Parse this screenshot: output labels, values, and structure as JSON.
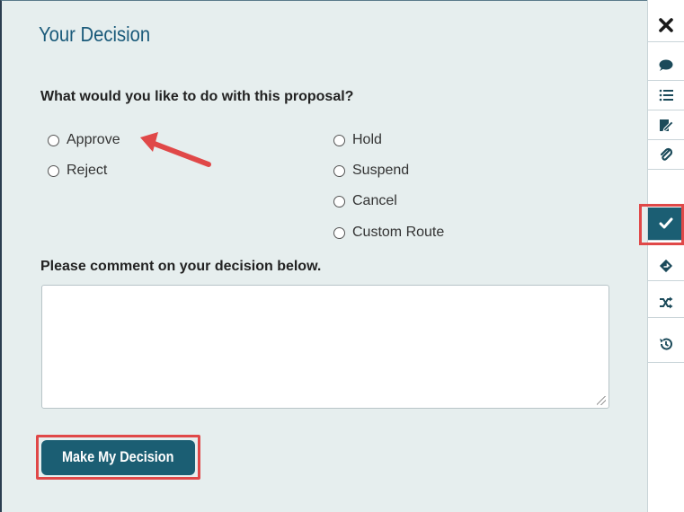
{
  "panel": {
    "title": "Your Decision",
    "question": "What would you like to do with this proposal?",
    "options": {
      "approve": "Approve",
      "reject": "Reject",
      "hold": "Hold",
      "suspend": "Suspend",
      "cancel": "Cancel",
      "custom_route": "Custom Route"
    },
    "comment_label": "Please comment on your decision below.",
    "comment_value": "",
    "submit_label": "Make My Decision"
  },
  "sidebar": {
    "items": [
      "close-icon",
      "comment-icon",
      "list-icon",
      "edit-icon",
      "paperclip-icon",
      "check-icon",
      "route-icon",
      "shuffle-icon",
      "history-icon"
    ],
    "active_item": "check-icon"
  },
  "colors": {
    "panel_bg": "#e6eeee",
    "accent": "#1b5e73",
    "highlight": "#e04848",
    "title": "#1a5a7a"
  }
}
